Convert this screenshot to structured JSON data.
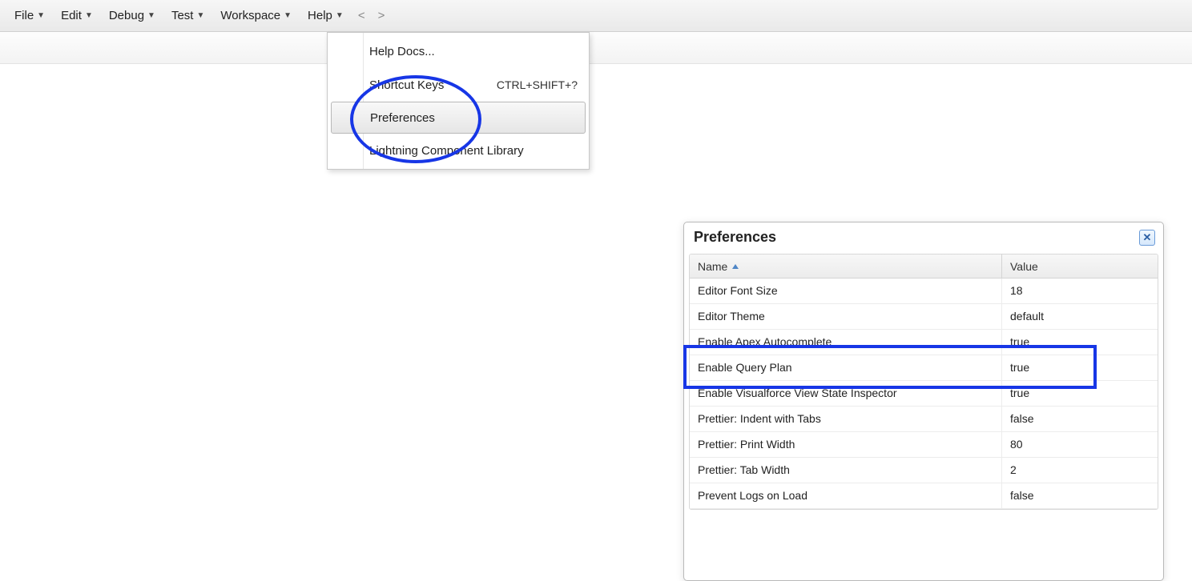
{
  "menubar": {
    "items": [
      {
        "label": "File"
      },
      {
        "label": "Edit"
      },
      {
        "label": "Debug"
      },
      {
        "label": "Test"
      },
      {
        "label": "Workspace"
      },
      {
        "label": "Help"
      }
    ],
    "nav_prev": "<",
    "nav_next": ">"
  },
  "help_menu": {
    "help_docs": "Help Docs...",
    "shortcut_keys": "Shortcut Keys",
    "shortcut_keys_accel": "CTRL+SHIFT+?",
    "preferences": "Preferences",
    "lightning_lib": "Lightning Component Library"
  },
  "prefs": {
    "title": "Preferences",
    "close_glyph": "✕",
    "columns": {
      "name": "Name",
      "value": "Value"
    },
    "rows": [
      {
        "name": "Editor Font Size",
        "value": "18"
      },
      {
        "name": "Editor Theme",
        "value": "default"
      },
      {
        "name": "Enable Apex Autocomplete",
        "value": "true"
      },
      {
        "name": "Enable Query Plan",
        "value": "true"
      },
      {
        "name": "Enable Visualforce View State Inspector",
        "value": "true"
      },
      {
        "name": "Prettier: Indent with Tabs",
        "value": "false"
      },
      {
        "name": "Prettier: Print Width",
        "value": "80"
      },
      {
        "name": "Prettier: Tab Width",
        "value": "2"
      },
      {
        "name": "Prevent Logs on Load",
        "value": "false"
      }
    ]
  }
}
